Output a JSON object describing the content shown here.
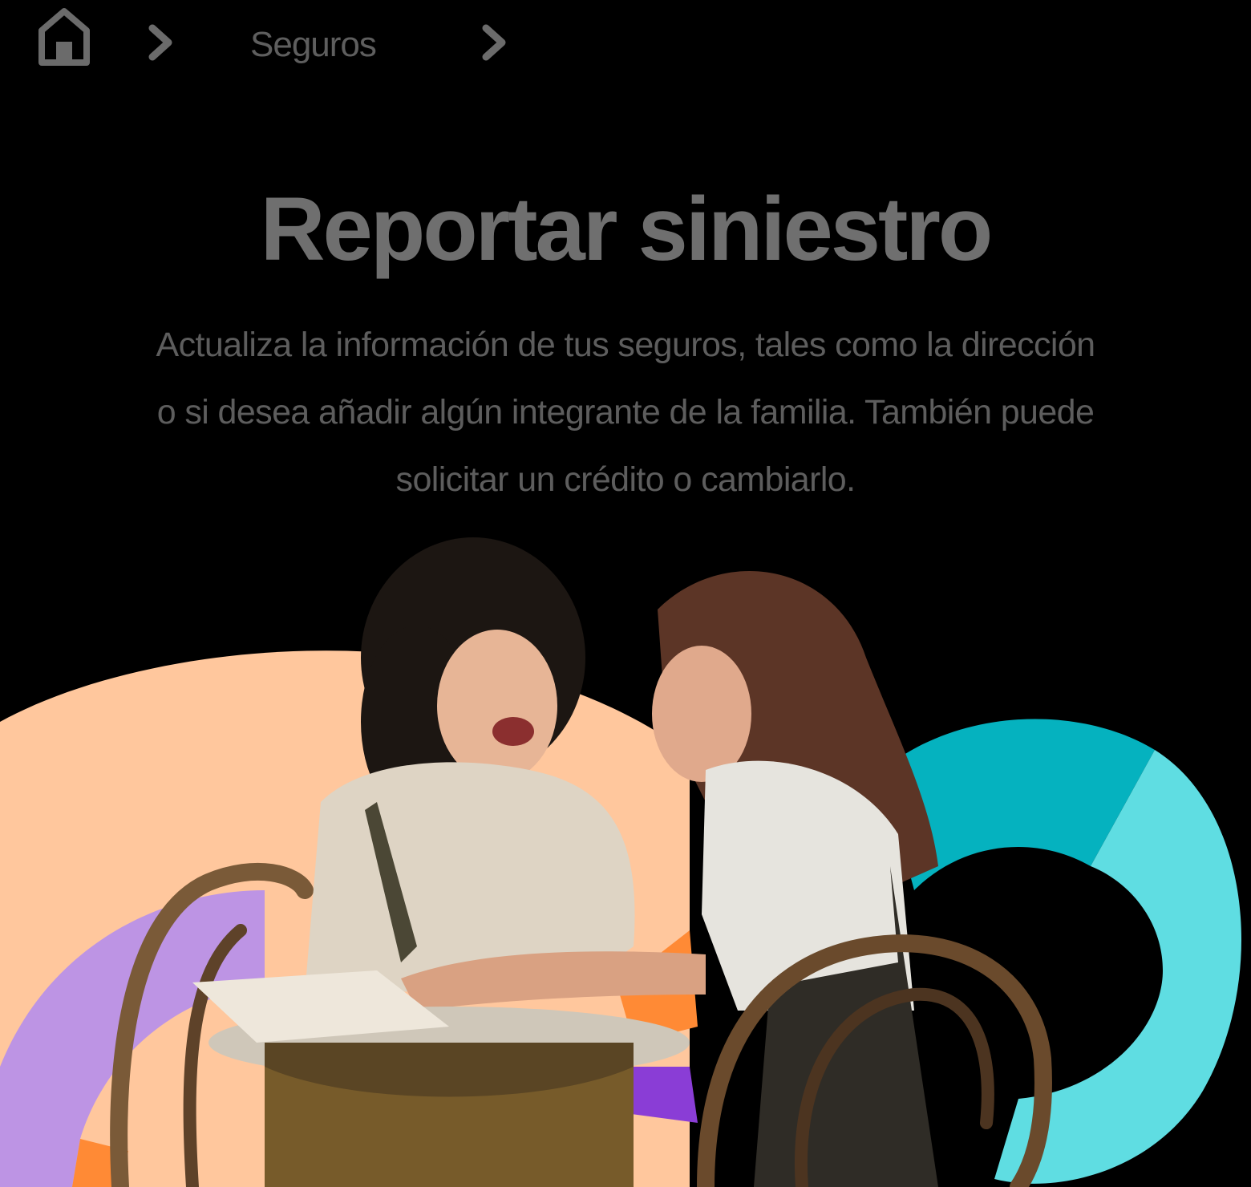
{
  "breadcrumb": {
    "home_icon": "home-icon",
    "separator_icon": "chevron-right-icon",
    "items": [
      {
        "label": "Seguros"
      }
    ]
  },
  "hero": {
    "title": "Reportar siniestro",
    "description": "Actualiza la información de tus seguros, tales como la dirección o si desea añadir algún integrante de la familia. También puede solicitar un crédito o cambiarlo."
  },
  "illustration": {
    "subject": "two-women-laughing-at-table-photo",
    "colors": {
      "peach": "#ffc79d",
      "lavender": "#bd94e4",
      "purple": "#8a3dd6",
      "orange": "#ff8a35",
      "teal": "#05b2bf",
      "cyan": "#5fdde2",
      "text_gray": "#6b6b6b",
      "background": "#000000"
    }
  }
}
